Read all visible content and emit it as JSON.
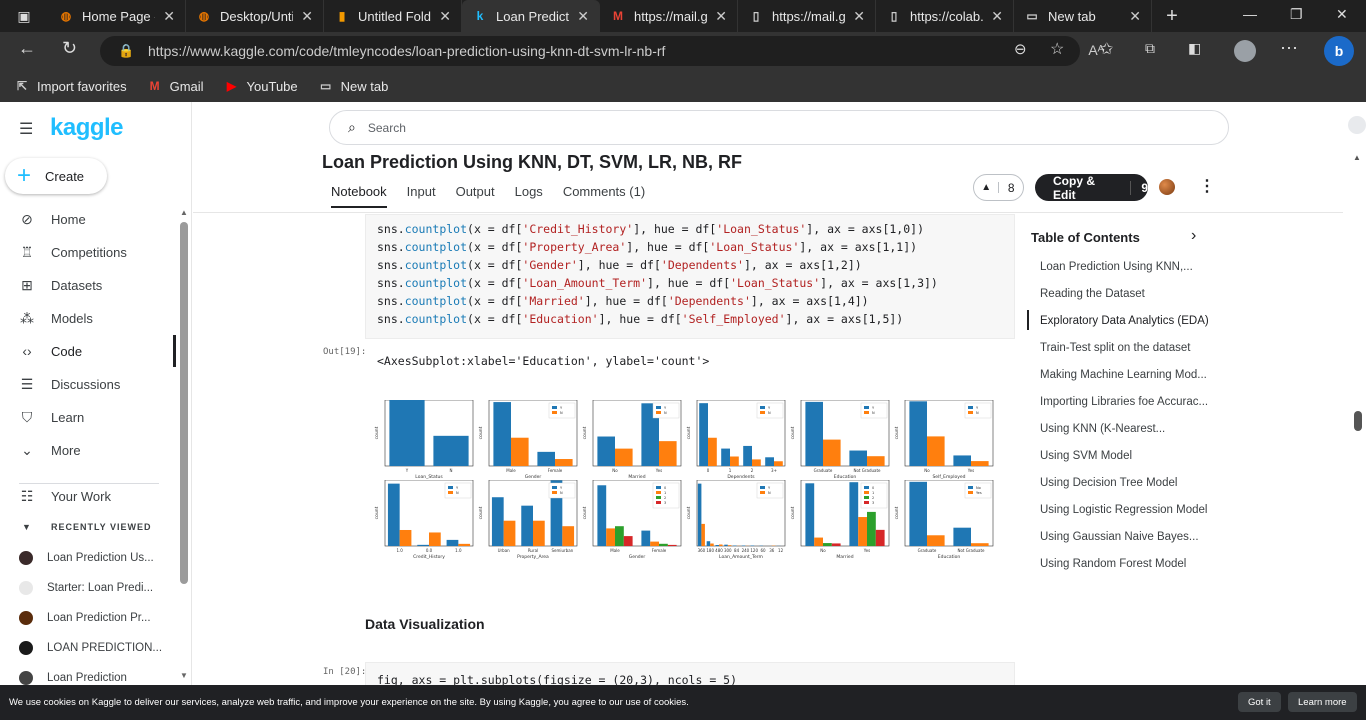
{
  "browser": {
    "tabs": [
      {
        "title": "Home Page -",
        "icon": "colab-icon"
      },
      {
        "title": "Desktop/Untit",
        "icon": "colab-icon"
      },
      {
        "title": "Untitled Folde",
        "icon": "folder-icon"
      },
      {
        "title": "Loan Predictio",
        "icon": "kaggle-icon",
        "active": true
      },
      {
        "title": "https://mail.g",
        "icon": "gmail-icon"
      },
      {
        "title": "https://mail.g",
        "icon": "page-icon"
      },
      {
        "title": "https://colab.",
        "icon": "page-icon"
      },
      {
        "title": "New tab",
        "icon": "newtab-icon"
      }
    ],
    "url": "https://www.kaggle.com/code/tmleyncodes/loan-prediction-using-knn-dt-svm-lr-nb-rf",
    "favorites": [
      {
        "label": "Import favorites"
      },
      {
        "label": "Gmail"
      },
      {
        "label": "YouTube"
      },
      {
        "label": "New tab"
      }
    ]
  },
  "kaggle": {
    "logo": "kaggle",
    "create": "Create",
    "nav": [
      "Home",
      "Competitions",
      "Datasets",
      "Models",
      "Code",
      "Discussions",
      "Learn",
      "More"
    ],
    "your_work": "Your Work",
    "recently_viewed": "RECENTLY VIEWED",
    "recent": [
      "Loan Prediction Us...",
      "Starter: Loan Predi...",
      "Loan Prediction Pr...",
      "LOAN PREDICTION...",
      "Loan Prediction"
    ]
  },
  "search": {
    "placeholder": "Search"
  },
  "notebook": {
    "title": "Loan Prediction Using KNN, DT, SVM, LR, NB, RF",
    "tabs": [
      "Notebook",
      "Input",
      "Output",
      "Logs",
      "Comments (1)"
    ],
    "votes": "8",
    "copy_edit": "Copy & Edit",
    "copy_count": "9",
    "code_lines": [
      {
        "pre": "sns.",
        "fn": "countplot",
        "mid": "(x = df[",
        "s1": "'Credit_History'",
        "mid2": "], hue = df[",
        "s2": "'Loan_Status'",
        "end": "], ax = axs[1,0])"
      },
      {
        "pre": "sns.",
        "fn": "countplot",
        "mid": "(x = df[",
        "s1": "'Property_Area'",
        "mid2": "], hue = df[",
        "s2": "'Loan_Status'",
        "end": "], ax = axs[1,1])"
      },
      {
        "pre": "sns.",
        "fn": "countplot",
        "mid": "(x = df[",
        "s1": "'Gender'",
        "mid2": "], hue = df[",
        "s2": "'Dependents'",
        "end": "], ax = axs[1,2])"
      },
      {
        "pre": "sns.",
        "fn": "countplot",
        "mid": "(x = df[",
        "s1": "'Loan_Amount_Term'",
        "mid2": "], hue = df[",
        "s2": "'Loan_Status'",
        "end": "], ax = axs[1,3])"
      },
      {
        "pre": "sns.",
        "fn": "countplot",
        "mid": "(x = df[",
        "s1": "'Married'",
        "mid2": "], hue = df[",
        "s2": "'Dependents'",
        "end": "], ax = axs[1,4])"
      },
      {
        "pre": "sns.",
        "fn": "countplot",
        "mid": "(x = df[",
        "s1": "'Education'",
        "mid2": "], hue = df[",
        "s2": "'Self_Employed'",
        "end": "], ax = axs[1,5])"
      }
    ],
    "out_label": "Out[19]:",
    "out_text": "<AxesSubplot:xlabel='Education', ylabel='count'>",
    "section_title": "Data Visualization",
    "in_label": "In [20]:",
    "next_code": "fig, axs = plt.subplots(figsize = (20,3), ncols = 5)"
  },
  "toc": {
    "title": "Table of Contents",
    "items": [
      "Loan Prediction Using KNN,...",
      "Reading the Dataset",
      "Exploratory Data Analytics (EDA)",
      "Train-Test split on the dataset",
      "Making Machine Learning Mod...",
      "Importing Libraries foe Accurac...",
      "Using KNN (K-Nearest...",
      "Using SVM Model",
      "Using Decision Tree Model",
      "Using Logistic Regression Model",
      "Using Gaussian Naive Bayes...",
      "Using Random Forest Model"
    ],
    "active_index": 2
  },
  "cookie": {
    "text": "We use cookies on Kaggle to deliver our services, analyze web traffic, and improve your experience on the site. By using Kaggle, you agree to our use of cookies.",
    "got_it": "Got it",
    "learn_more": "Learn more"
  },
  "colors": {
    "kaggle_blue": "#20beff",
    "series_blue": "#1f77b4",
    "series_orange": "#ff7f0e",
    "series_green": "#2ca02c",
    "series_red": "#d62728"
  },
  "chart_data": [
    {
      "type": "bar",
      "xlabel": "Loan_Status",
      "ylabel": "count",
      "categories": [
        "Y",
        "N"
      ],
      "values": [
        422,
        192
      ],
      "ylim": [
        0,
        420
      ]
    },
    {
      "type": "bar",
      "xlabel": "Gender",
      "ylabel": "count",
      "categories": [
        "Male",
        "Female"
      ],
      "series": [
        {
          "name": "Y",
          "values": [
            339,
            75
          ]
        },
        {
          "name": "N",
          "values": [
            150,
            37
          ]
        }
      ],
      "ylim": [
        0,
        350
      ]
    },
    {
      "type": "bar",
      "xlabel": "Married",
      "ylabel": "count",
      "categories": [
        "No",
        "Yes"
      ],
      "series": [
        {
          "name": "Y",
          "values": [
            134,
            285
          ]
        },
        {
          "name": "N",
          "values": [
            79,
            113
          ]
        }
      ],
      "ylim": [
        0,
        300
      ]
    },
    {
      "type": "bar",
      "xlabel": "Dependents",
      "ylabel": "count",
      "categories": [
        "0",
        "1",
        "2",
        "3+"
      ],
      "series": [
        {
          "name": "Y",
          "values": [
            238,
            66,
            76,
            33
          ]
        },
        {
          "name": "N",
          "values": [
            107,
            36,
            25,
            18
          ]
        }
      ],
      "ylim": [
        0,
        250
      ]
    },
    {
      "type": "bar",
      "xlabel": "Education",
      "ylabel": "count",
      "categories": [
        "Graduate",
        "Not Graduate"
      ],
      "series": [
        {
          "name": "Y",
          "values": [
            340,
            82
          ]
        },
        {
          "name": "N",
          "values": [
            140,
            52
          ]
        }
      ],
      "ylim": [
        0,
        350
      ]
    },
    {
      "type": "bar",
      "xlabel": "Self_Employed",
      "ylabel": "count",
      "categories": [
        "No",
        "Yes"
      ],
      "series": [
        {
          "name": "Y",
          "values": [
            343,
            56
          ]
        },
        {
          "name": "N",
          "values": [
            157,
            26
          ]
        }
      ],
      "ylim": [
        0,
        350
      ]
    },
    {
      "type": "bar",
      "xlabel": "Credit_History",
      "ylabel": "count",
      "categories": [
        "1.0",
        "0.0",
        "1.0"
      ],
      "series": [
        {
          "name": "Y",
          "values": [
            378,
            7,
            37
          ]
        },
        {
          "name": "N",
          "values": [
            97,
            82,
            13
          ]
        }
      ],
      "ylim": [
        0,
        400
      ]
    },
    {
      "type": "bar",
      "xlabel": "Property_Area",
      "ylabel": "count",
      "categories": [
        "Urban",
        "Rural",
        "Semiurban"
      ],
      "series": [
        {
          "name": "Y",
          "values": [
            133,
            110,
            179
          ]
        },
        {
          "name": "N",
          "values": [
            69,
            69,
            54
          ]
        }
      ],
      "ylim": [
        0,
        180
      ]
    },
    {
      "type": "bar",
      "xlabel": "Gender",
      "ylabel": "count",
      "categories": [
        "Male",
        "Female"
      ],
      "series": [
        {
          "name": "0",
          "values": [
            276,
            70
          ]
        },
        {
          "name": "1",
          "values": [
            80,
            20
          ]
        },
        {
          "name": "2",
          "values": [
            90,
            10
          ]
        },
        {
          "name": "3",
          "values": [
            45,
            5
          ]
        }
      ],
      "ylim": [
        0,
        300
      ]
    },
    {
      "type": "bar",
      "xlabel": "Loan_Amount_Term",
      "ylabel": "count",
      "categories": [
        "360",
        "180",
        "480",
        "300",
        "84",
        "240",
        "120",
        "60",
        "36",
        "12"
      ],
      "series": [
        {
          "name": "Y",
          "values": [
            378,
            29,
            6,
            8,
            3,
            3,
            3,
            2,
            0,
            1
          ]
        },
        {
          "name": "N",
          "values": [
            134,
            15,
            9,
            5,
            1,
            1,
            0,
            0,
            2,
            0
          ]
        }
      ],
      "ylim": [
        0,
        400
      ]
    },
    {
      "type": "bar",
      "xlabel": "Married",
      "ylabel": "count",
      "categories": [
        "No",
        "Yes"
      ],
      "series": [
        {
          "name": "0",
          "values": [
            171,
            174
          ]
        },
        {
          "name": "1",
          "values": [
            23,
            79
          ]
        },
        {
          "name": "2",
          "values": [
            8,
            93
          ]
        },
        {
          "name": "3",
          "values": [
            7,
            44
          ]
        }
      ],
      "ylim": [
        0,
        180
      ]
    },
    {
      "type": "bar",
      "xlabel": "Education",
      "ylabel": "count",
      "categories": [
        "Graduate",
        "Not Graduate"
      ],
      "series": [
        {
          "name": "No",
          "values": [
            389,
            111
          ]
        },
        {
          "name": "Yes",
          "values": [
            65,
            17
          ]
        }
      ],
      "ylim": [
        0,
        400
      ]
    }
  ]
}
